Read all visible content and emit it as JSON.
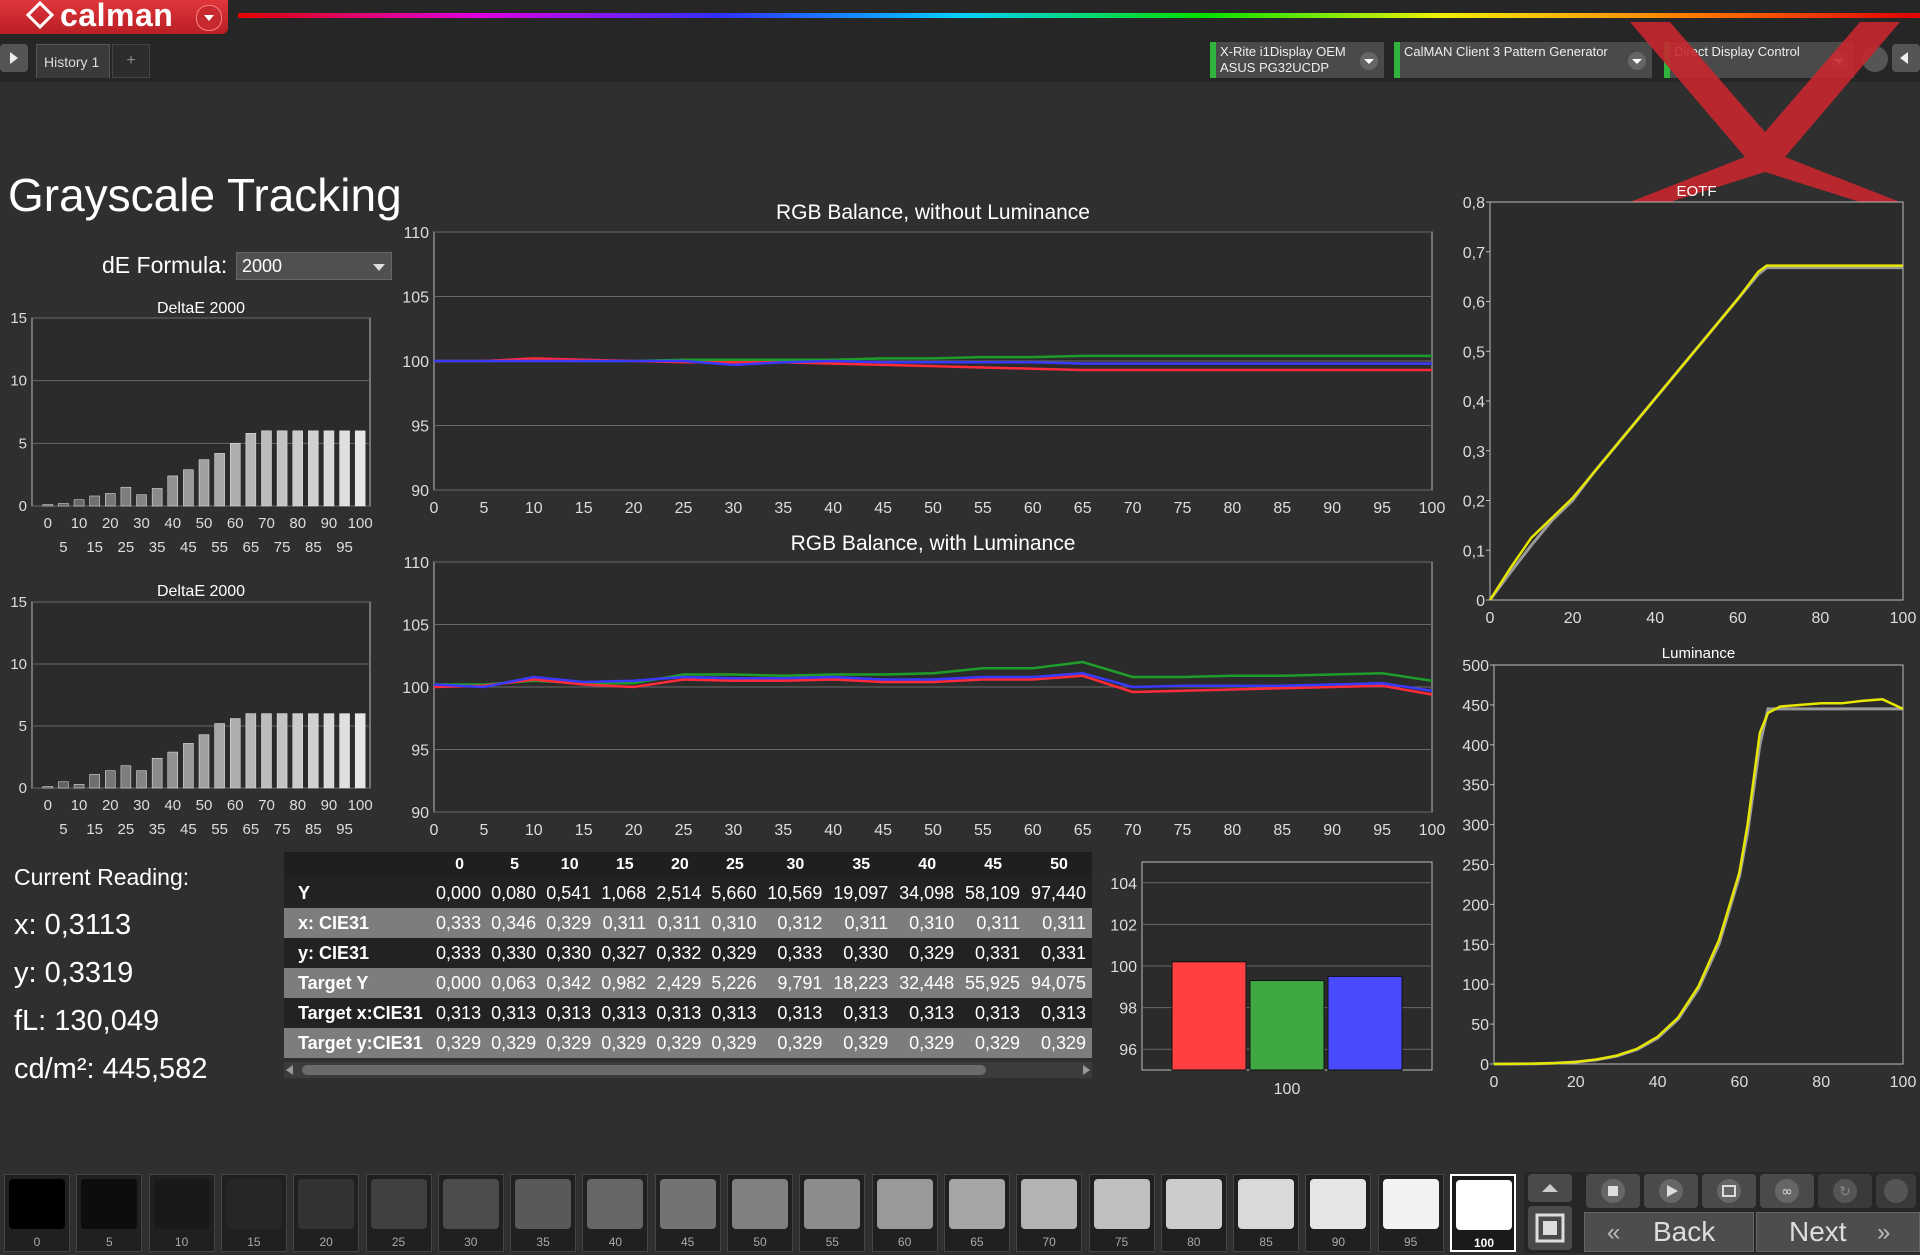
{
  "app": {
    "logo_text": "calman",
    "tab_label": "History 1",
    "tab_add": "+"
  },
  "devices": [
    {
      "line1": "X-Rite i1Display OEM",
      "line2": "ASUS PG32UCDP"
    },
    {
      "line1": "CalMAN Client 3 Pattern Generator",
      "line2": ""
    },
    {
      "line1": "Direct Display Control",
      "line2": ""
    }
  ],
  "page": {
    "title": "Grayscale Tracking",
    "de_formula_label": "dE Formula:",
    "de_formula_value": "2000"
  },
  "current_reading": {
    "title": "Current Reading:",
    "x": "x: 0,3113",
    "y": "y: 0,3319",
    "fl": "fL: 130,049",
    "cdm2": "cd/m²: 445,582"
  },
  "table": {
    "headers": [
      "",
      "0",
      "5",
      "10",
      "15",
      "20",
      "25",
      "30",
      "35",
      "40",
      "45",
      "50"
    ],
    "rows": [
      {
        "label": "Y",
        "values": [
          "0,000",
          "0,080",
          "0,541",
          "1,068",
          "2,514",
          "5,660",
          "10,569",
          "19,097",
          "34,098",
          "58,109",
          "97,440"
        ]
      },
      {
        "label": "x: CIE31",
        "values": [
          "0,333",
          "0,346",
          "0,329",
          "0,311",
          "0,311",
          "0,310",
          "0,312",
          "0,311",
          "0,310",
          "0,311",
          "0,311"
        ]
      },
      {
        "label": "y: CIE31",
        "values": [
          "0,333",
          "0,330",
          "0,330",
          "0,327",
          "0,332",
          "0,329",
          "0,333",
          "0,330",
          "0,329",
          "0,331",
          "0,331"
        ]
      },
      {
        "label": "Target Y",
        "values": [
          "0,000",
          "0,063",
          "0,342",
          "0,982",
          "2,429",
          "5,226",
          "9,791",
          "18,223",
          "32,448",
          "55,925",
          "94,075"
        ]
      },
      {
        "label": "Target x:CIE31",
        "values": [
          "0,313",
          "0,313",
          "0,313",
          "0,313",
          "0,313",
          "0,313",
          "0,313",
          "0,313",
          "0,313",
          "0,313",
          "0,313"
        ]
      },
      {
        "label": "Target y:CIE31",
        "values": [
          "0,329",
          "0,329",
          "0,329",
          "0,329",
          "0,329",
          "0,329",
          "0,329",
          "0,329",
          "0,329",
          "0,329",
          "0,329"
        ]
      }
    ]
  },
  "patches": {
    "labels": [
      "0",
      "5",
      "10",
      "15",
      "20",
      "25",
      "30",
      "35",
      "40",
      "45",
      "50",
      "55",
      "60",
      "65",
      "70",
      "75",
      "80",
      "85",
      "90",
      "95",
      "100"
    ],
    "grays": [
      "#000000",
      "#0d0d0d",
      "#191919",
      "#262626",
      "#333333",
      "#404040",
      "#4c4c4c",
      "#595959",
      "#666666",
      "#737373",
      "#808080",
      "#8c8c8c",
      "#999999",
      "#a6a6a6",
      "#b3b3b3",
      "#bfbfbf",
      "#cccccc",
      "#d9d9d9",
      "#e6e6e6",
      "#f2f2f2",
      "#ffffff"
    ],
    "active": "100"
  },
  "controls": {
    "back": "Back",
    "next": "Next"
  },
  "colors": {
    "red": "#ff2a3a",
    "green": "#1f9d2a",
    "blue": "#3a3aff",
    "curve": "#e6e600",
    "reference": "#9a9a9a"
  },
  "chart_data": [
    {
      "type": "bar",
      "title": "DeltaE 2000",
      "categories": [
        "0",
        "5",
        "10",
        "15",
        "20",
        "25",
        "30",
        "35",
        "40",
        "45",
        "50",
        "55",
        "60",
        "65",
        "70",
        "75",
        "80",
        "85",
        "90",
        "95",
        "100"
      ],
      "values": [
        0.0,
        0.2,
        0.5,
        0.8,
        1.0,
        1.5,
        0.9,
        1.4,
        2.4,
        2.9,
        3.7,
        4.2,
        5.0,
        5.8,
        6.0,
        6.0,
        6.0,
        6.0,
        6.0,
        6.0,
        6.0
      ],
      "ylim": [
        0,
        15
      ],
      "yticks": [
        0,
        5,
        10,
        15
      ],
      "xticks_top": [
        "0",
        "10",
        "20",
        "30",
        "40",
        "50",
        "60",
        "70",
        "80",
        "90",
        "100"
      ],
      "xticks_bottom": [
        "5",
        "15",
        "25",
        "35",
        "45",
        "55",
        "65",
        "75",
        "85",
        "95"
      ]
    },
    {
      "type": "bar",
      "title": "DeltaE 2000",
      "categories": [
        "0",
        "5",
        "10",
        "15",
        "20",
        "25",
        "30",
        "35",
        "40",
        "45",
        "50",
        "55",
        "60",
        "65",
        "70",
        "75",
        "80",
        "85",
        "90",
        "95",
        "100"
      ],
      "values": [
        0.0,
        0.5,
        0.3,
        1.1,
        1.4,
        1.8,
        1.4,
        2.4,
        2.9,
        3.6,
        4.3,
        5.2,
        5.6,
        6.0,
        6.0,
        6.0,
        6.0,
        6.0,
        6.0,
        6.0,
        6.0
      ],
      "ylim": [
        0,
        15
      ],
      "yticks": [
        0,
        5,
        10,
        15
      ],
      "xticks_top": [
        "0",
        "10",
        "20",
        "30",
        "40",
        "50",
        "60",
        "70",
        "80",
        "90",
        "100"
      ],
      "xticks_bottom": [
        "5",
        "15",
        "25",
        "35",
        "45",
        "55",
        "65",
        "75",
        "85",
        "95"
      ]
    },
    {
      "type": "line",
      "title": "RGB Balance, without Luminance",
      "x": [
        0,
        5,
        10,
        15,
        20,
        25,
        30,
        35,
        40,
        45,
        50,
        55,
        60,
        65,
        70,
        75,
        80,
        85,
        90,
        95,
        100
      ],
      "series": [
        {
          "values": [
            100.0,
            100.0,
            100.1,
            100.0,
            100.0,
            100.1,
            100.1,
            100.1,
            100.1,
            100.2,
            100.2,
            100.3,
            100.3,
            100.4,
            100.4,
            100.4,
            100.4,
            100.4,
            100.4,
            100.4,
            100.4
          ]
        },
        {
          "values": [
            100.0,
            100.0,
            100.2,
            100.1,
            100.0,
            99.9,
            99.9,
            99.9,
            99.8,
            99.7,
            99.6,
            99.5,
            99.4,
            99.3,
            99.3,
            99.3,
            99.3,
            99.3,
            99.3,
            99.3,
            99.3
          ]
        },
        {
          "values": [
            100.0,
            100.0,
            100.0,
            100.0,
            100.0,
            100.0,
            99.7,
            99.9,
            100.0,
            99.9,
            99.9,
            99.9,
            99.9,
            99.8,
            99.8,
            99.8,
            99.8,
            99.8,
            99.8,
            99.8,
            99.8
          ]
        }
      ],
      "ylim": [
        90,
        110
      ],
      "yticks": [
        90,
        95,
        100,
        105,
        110
      ],
      "xticks": [
        0,
        5,
        10,
        15,
        20,
        25,
        30,
        35,
        40,
        45,
        50,
        55,
        60,
        65,
        70,
        75,
        80,
        85,
        90,
        95,
        100
      ]
    },
    {
      "type": "line",
      "title": "RGB Balance, with Luminance",
      "x": [
        0,
        5,
        10,
        15,
        20,
        25,
        30,
        35,
        40,
        45,
        50,
        55,
        60,
        65,
        70,
        75,
        80,
        85,
        90,
        95,
        100
      ],
      "series": [
        {
          "values": [
            100.2,
            100.2,
            100.5,
            100.3,
            100.3,
            101.0,
            101.0,
            100.9,
            101.0,
            101.0,
            101.1,
            101.5,
            101.5,
            102.0,
            100.8,
            100.8,
            100.9,
            100.9,
            101.0,
            101.1,
            100.5
          ]
        },
        {
          "values": [
            100.0,
            100.1,
            100.6,
            100.2,
            100.0,
            100.6,
            100.5,
            100.5,
            100.6,
            100.4,
            100.4,
            100.6,
            100.6,
            100.9,
            99.6,
            99.7,
            99.8,
            99.9,
            100.0,
            100.1,
            99.4
          ]
        },
        {
          "values": [
            100.2,
            100.0,
            100.8,
            100.4,
            100.5,
            100.8,
            100.7,
            100.7,
            100.8,
            100.6,
            100.6,
            100.8,
            100.8,
            101.1,
            100.0,
            100.1,
            100.1,
            100.1,
            100.2,
            100.3,
            99.7
          ]
        }
      ],
      "ylim": [
        90,
        110
      ],
      "yticks": [
        90,
        95,
        100,
        105,
        110
      ],
      "xticks": [
        0,
        5,
        10,
        15,
        20,
        25,
        30,
        35,
        40,
        45,
        50,
        55,
        60,
        65,
        70,
        75,
        80,
        85,
        90,
        95,
        100
      ]
    },
    {
      "type": "bar",
      "categories": [
        "100"
      ],
      "series": [
        {
          "values": [
            99.3
          ]
        },
        {
          "values": [
            100.2
          ]
        },
        {
          "values": [
            99.5
          ]
        }
      ],
      "ylim": [
        95,
        105
      ],
      "yticks": [
        96,
        98,
        100,
        102,
        104
      ]
    },
    {
      "type": "line",
      "title": "EOTF",
      "x": [
        0,
        5,
        10,
        15,
        20,
        25,
        30,
        35,
        40,
        45,
        50,
        55,
        60,
        65,
        67,
        70,
        75,
        80,
        85,
        90,
        95,
        100
      ],
      "series": [
        {
          "values": [
            0.0,
            0.056,
            0.11,
            0.16,
            0.2,
            0.255,
            0.305,
            0.355,
            0.405,
            0.455,
            0.505,
            0.555,
            0.605,
            0.655,
            0.668,
            0.668,
            0.668,
            0.668,
            0.668,
            0.668,
            0.668,
            0.668
          ]
        },
        {
          "values": [
            0.0,
            0.065,
            0.125,
            0.165,
            0.205,
            0.255,
            0.305,
            0.355,
            0.405,
            0.455,
            0.505,
            0.555,
            0.605,
            0.66,
            0.672,
            0.672,
            0.672,
            0.672,
            0.672,
            0.672,
            0.672,
            0.672
          ]
        }
      ],
      "ylim": [
        0,
        0.8
      ],
      "xlim": [
        0,
        100
      ],
      "yticks": [
        "0",
        "0,1",
        "0,2",
        "0,3",
        "0,4",
        "0,5",
        "0,6",
        "0,7",
        "0,8"
      ],
      "xticks": [
        0,
        20,
        40,
        60,
        80,
        100
      ]
    },
    {
      "type": "line",
      "title": "Luminance",
      "x": [
        0,
        10,
        15,
        20,
        25,
        30,
        35,
        40,
        45,
        50,
        55,
        60,
        62,
        65,
        67,
        70,
        75,
        80,
        85,
        90,
        95,
        100
      ],
      "series": [
        {
          "values": [
            0,
            0.3,
            1.1,
            2.5,
            5.2,
            9.8,
            18.2,
            32.4,
            55.9,
            94.1,
            150,
            235,
            290,
            400,
            445,
            445,
            445,
            445,
            445,
            445,
            445,
            445
          ]
        },
        {
          "values": [
            0,
            0.5,
            1.1,
            2.5,
            5.7,
            10.6,
            19.1,
            34.1,
            58.1,
            97.4,
            155,
            240,
            300,
            415,
            440,
            448,
            450,
            452,
            452,
            455,
            457,
            445
          ]
        }
      ],
      "ylim": [
        0,
        500
      ],
      "xlim": [
        0,
        100
      ],
      "yticks": [
        0,
        50,
        100,
        150,
        200,
        250,
        300,
        350,
        400,
        450,
        500
      ],
      "xticks": [
        0,
        20,
        40,
        60,
        80,
        100
      ]
    }
  ]
}
